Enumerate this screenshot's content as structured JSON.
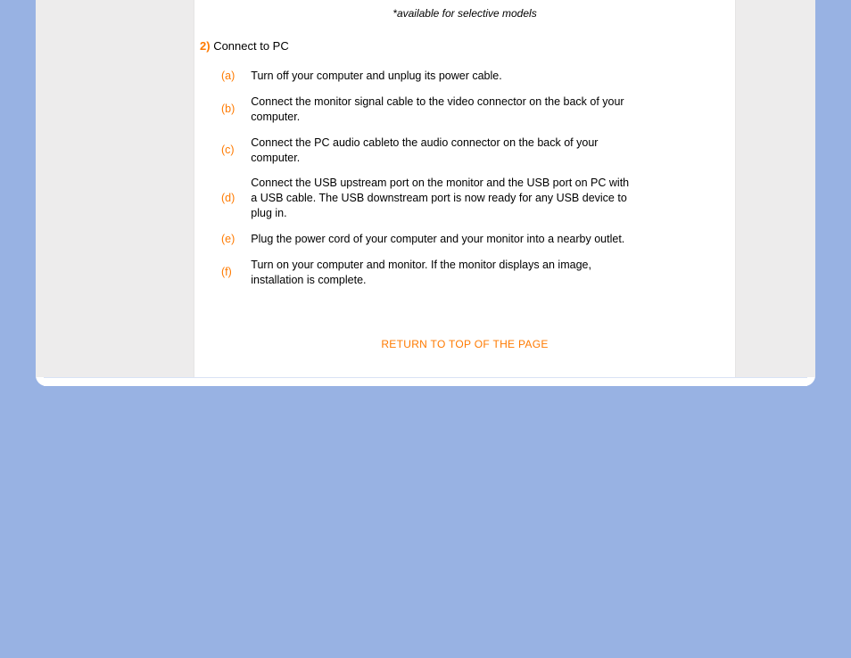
{
  "note": "*available for selective models",
  "section": {
    "number": "2)",
    "title": "Connect to PC"
  },
  "steps": [
    {
      "label": "(a)",
      "text": "Turn off your computer and unplug its power cable."
    },
    {
      "label": "(b)",
      "text": "Connect the monitor signal cable to the video connector on the back of your computer."
    },
    {
      "label": "(c)",
      "text": "Connect the PC audio cableto the audio connector on the back of your computer."
    },
    {
      "label": "(d)",
      "text": "Connect the USB upstream port on the monitor and the USB port on PC with a USB cable. The USB downstream port is now ready for any USB device to plug in."
    },
    {
      "label": "(e)",
      "text": "Plug the power cord of your computer and your monitor into a nearby outlet."
    },
    {
      "label": "(f)",
      "text": "Turn on your computer and monitor. If the monitor displays an image, installation is complete."
    }
  ],
  "return_link": "RETURN TO TOP OF THE PAGE"
}
